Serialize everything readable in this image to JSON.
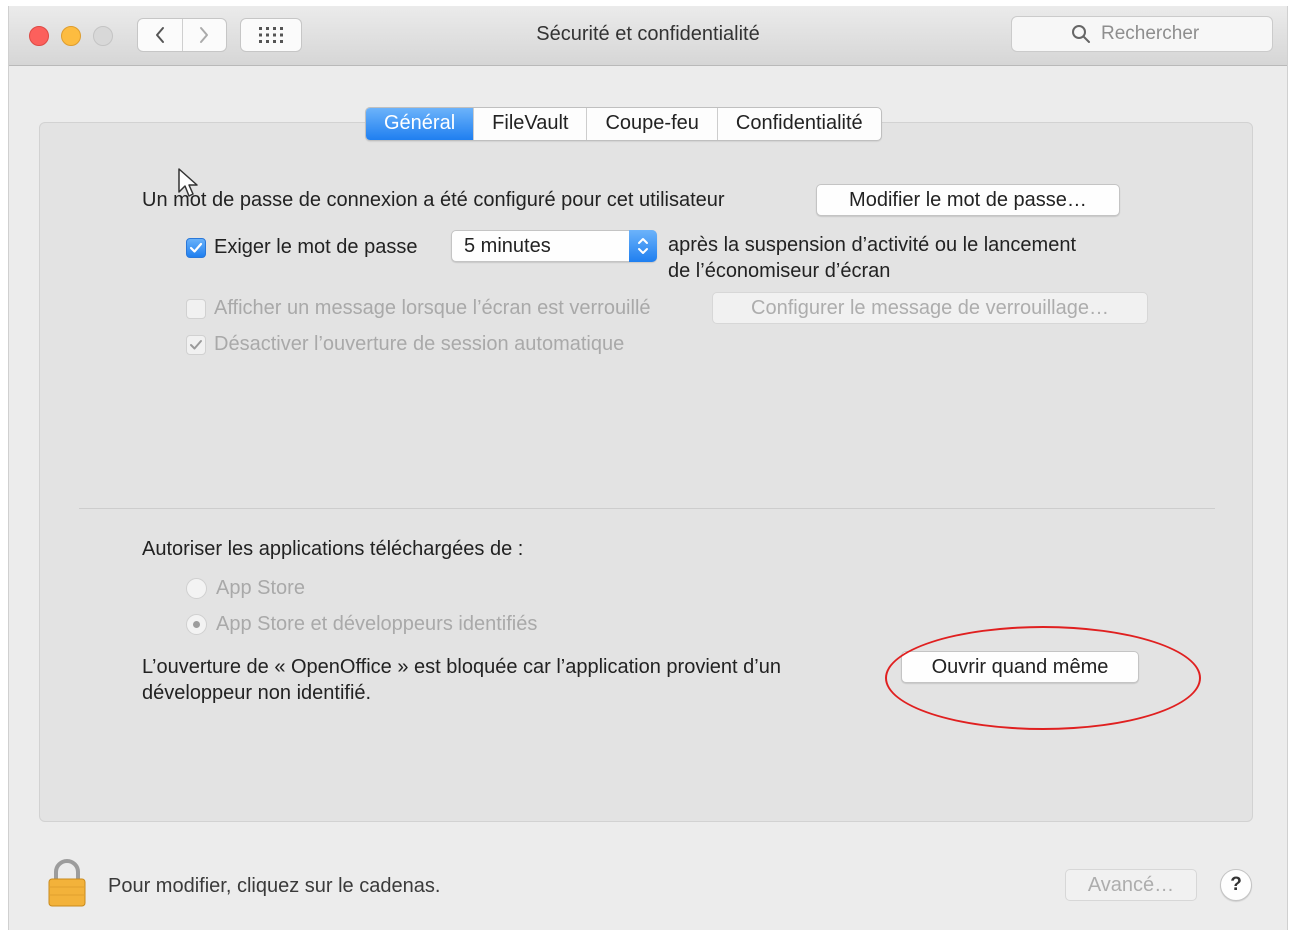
{
  "window": {
    "title": "Sécurité et confidentialité",
    "search_placeholder": "Rechercher"
  },
  "tabs": [
    {
      "label": "Général",
      "active": true
    },
    {
      "label": "FileVault",
      "active": false
    },
    {
      "label": "Coupe-feu",
      "active": false
    },
    {
      "label": "Confidentialité",
      "active": false
    }
  ],
  "general": {
    "password_text": "Un mot de passe de connexion a été configuré pour cet utilisateur",
    "change_password_button": "Modifier le mot de passe…",
    "require_password": {
      "label": "Exiger le mot de passe",
      "checked": true,
      "selected_option": "5 minutes",
      "after_line1": "après la suspension d’activité ou le lancement",
      "after_line2": "de l’économiseur d’écran"
    },
    "show_message": {
      "label": "Afficher un message lorsque l’écran est verrouillé",
      "checked": false,
      "enabled": false,
      "button": "Configurer le message de verrouillage…"
    },
    "disable_auto_login": {
      "label": "Désactiver l’ouverture de session automatique",
      "checked": true,
      "enabled": false
    },
    "allow_apps": {
      "title": "Autoriser les applications téléchargées de :",
      "options": [
        {
          "label": "App Store",
          "selected": false
        },
        {
          "label": "App Store et développeurs identifiés",
          "selected": true
        }
      ]
    },
    "blocked": {
      "line1": "L’ouverture de « OpenOffice » est bloquée car l’application provient d’un",
      "line2": "développeur non identifié.",
      "button": "Ouvrir quand même"
    }
  },
  "footer": {
    "lock_text": "Pour modifier, cliquez sur le cadenas.",
    "advanced_button": "Avancé…",
    "help_label": "?"
  },
  "colors": {
    "accent": "#1f7ff0",
    "annotation": "#e02020",
    "close": "#fc605c",
    "minimize": "#fdbc40"
  }
}
